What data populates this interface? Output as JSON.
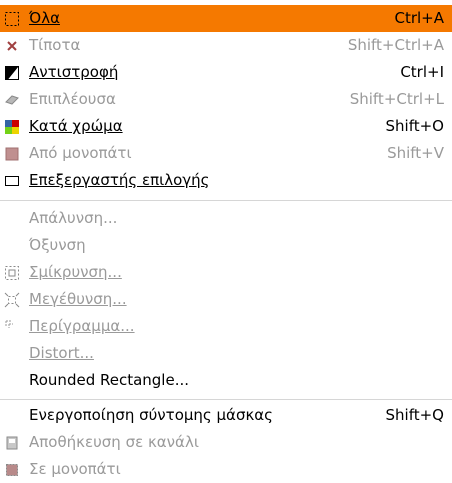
{
  "menu": {
    "items": [
      {
        "label": "Όλα",
        "accel": "Ctrl+A",
        "icon": "select-all-icon",
        "enabled": true,
        "selected": true
      },
      {
        "label": "Τίποτα",
        "accel": "Shift+Ctrl+A",
        "icon": "select-none-icon",
        "enabled": false
      },
      {
        "label": "Αντιστροφή",
        "accel": "Ctrl+I",
        "icon": "invert-selection-icon",
        "enabled": true
      },
      {
        "label": "Επιπλέουσα",
        "accel": "Shift+Ctrl+L",
        "icon": "float-selection-icon",
        "enabled": false
      },
      {
        "label": "Κατά χρώμα",
        "accel": "Shift+O",
        "icon": "select-by-color-icon",
        "enabled": true
      },
      {
        "label": "Από μονοπάτι",
        "accel": "Shift+V",
        "icon": "from-path-icon",
        "enabled": false
      },
      {
        "label": "Επεξεργαστής επιλογής",
        "accel": "",
        "icon": "selection-editor-icon",
        "enabled": true
      },
      {
        "label": "Απάλυνση...",
        "accel": "",
        "icon": "",
        "enabled": false
      },
      {
        "label": "Όξυνση",
        "accel": "",
        "icon": "",
        "enabled": false
      },
      {
        "label": "Σμίκρυνση...",
        "accel": "",
        "icon": "shrink-icon",
        "enabled": false
      },
      {
        "label": "Μεγέθυνση...",
        "accel": "",
        "icon": "grow-icon",
        "enabled": false
      },
      {
        "label": "Περίγραμμα...",
        "accel": "",
        "icon": "border-icon",
        "enabled": false
      },
      {
        "label": "Distort...",
        "accel": "",
        "icon": "",
        "enabled": false
      },
      {
        "label": "Rounded Rectangle...",
        "accel": "",
        "icon": "",
        "enabled": true
      },
      {
        "label": "Ενεργοποίηση σύντομης μάσκας",
        "accel": "Shift+Q",
        "icon": "",
        "enabled": true
      },
      {
        "label": "Αποθήκευση σε κανάλι",
        "accel": "",
        "icon": "save-to-channel-icon",
        "enabled": false
      },
      {
        "label": "Σε μονοπάτι",
        "accel": "",
        "icon": "to-path-icon",
        "enabled": false
      }
    ]
  }
}
